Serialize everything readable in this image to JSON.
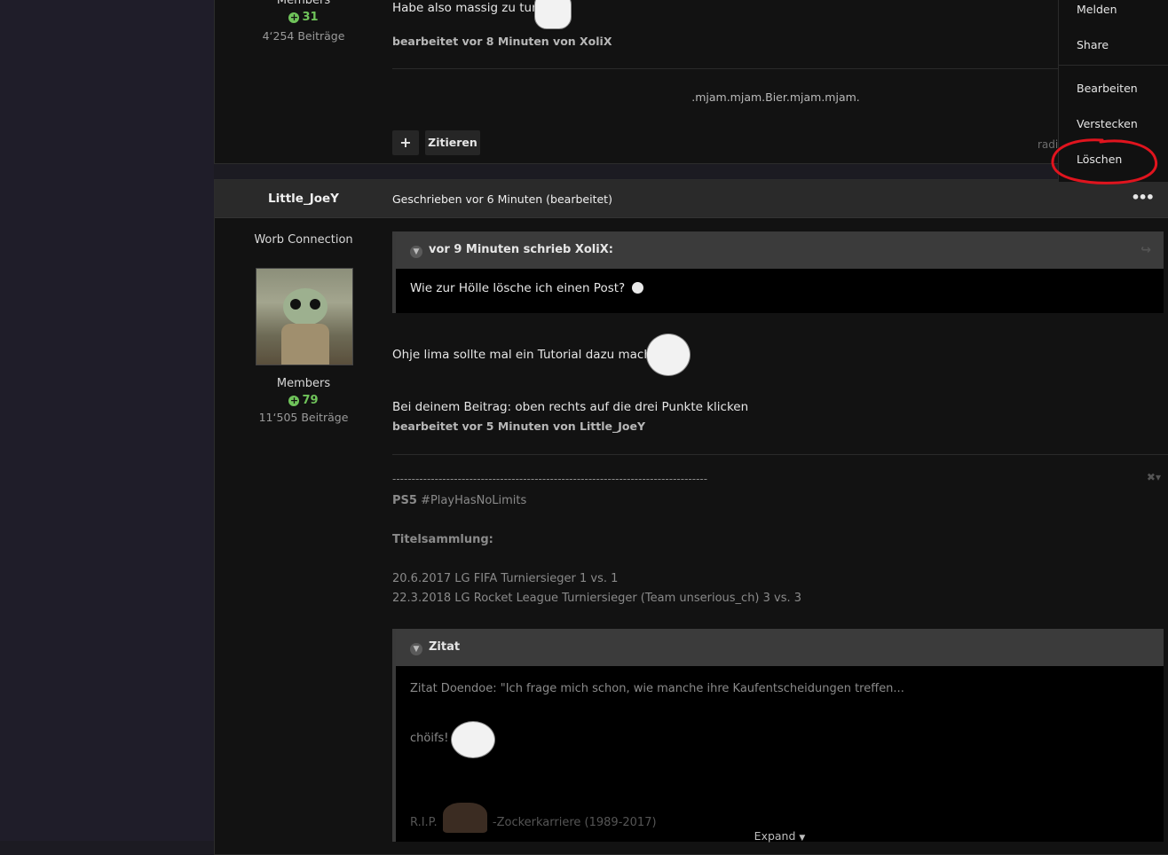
{
  "post1": {
    "author_rank": "Members",
    "reputation": "31",
    "post_count": "4‘254 Beiträge",
    "text_line": "Habe also massig zu tun.",
    "edited_note": "bearbeitet vor 8 Minuten von XoliX",
    "signature": ".mjam.mjam.Bier.mjam.mjam.",
    "add_button": "+",
    "quote_button": "Zitieren",
    "reactions_text": "radi"
  },
  "context_menu": {
    "items": [
      "Melden",
      "Share",
      "Bearbeiten",
      "Verstecken",
      "Löschen"
    ]
  },
  "post2": {
    "author_name": "Little_JoeY",
    "written_label": "Geschrieben vor 6 Minuten (bearbeitet)",
    "more_icon": "•••",
    "author_title": "Worb Connection",
    "author_rank": "Members",
    "reputation": "79",
    "post_count": "11‘505 Beiträge",
    "quote1": {
      "header": "vor 9 Minuten schrieb XoliX:",
      "body": "Wie zur Hölle lösche ich einen Post?"
    },
    "line1": "Ohje lima sollte mal ein Tutorial dazu machen",
    "line2": "Bei deinem Beitrag: oben rechts auf die drei Punkte klicken",
    "edited_note": "bearbeitet vor 5 Minuten von Little_JoeY",
    "signature": {
      "dashes": "----------------------------------------------------------------------------------",
      "ps5_bold": "PS5",
      "ps5_tag": "#PlayHasNoLimits",
      "titles_heading": "Titelsammlung:",
      "title1": "20.6.2017 LG FIFA Turniersieger 1 vs. 1",
      "title2": "22.3.2018 LG Rocket League Turniersieger (Team unserious_ch) 3 vs. 3",
      "quote_header": "Zitat",
      "quote_line1": "Zitat Doendoe: \"Ich frage mich schon, wie manche ihre Kaufentscheidungen treffen...",
      "quote_line2": "chöifs!",
      "quote_line3_prefix": "R.I.P.",
      "quote_line3_suffix": "-Zockerkarriere (1989-2017)",
      "expand_label": "Expand"
    }
  },
  "colors": {
    "reputation_green": "#6fc35a",
    "annotation_red": "#e0141e"
  }
}
